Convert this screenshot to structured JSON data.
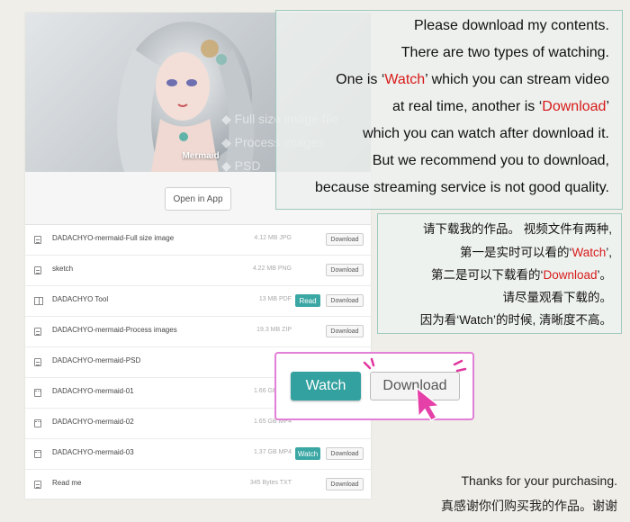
{
  "cover": {
    "title": "Mermaid",
    "features": [
      "Full size image file",
      "Process images",
      "PSD"
    ]
  },
  "open_button": "Open in App",
  "files": [
    {
      "icon": "document-icon",
      "name": "DADACHYO-mermaid-Full size image",
      "meta": "4.12 MB JPG",
      "read": "",
      "download": "Download"
    },
    {
      "icon": "document-icon",
      "name": "sketch",
      "meta": "4.22 MB PNG",
      "read": "",
      "download": "Download"
    },
    {
      "icon": "book-icon",
      "name": "DADACHYO Tool",
      "meta": "13 MB PDF",
      "read": "Read",
      "download": "Download"
    },
    {
      "icon": "document-icon",
      "name": "DADACHYO-mermaid-Process images",
      "meta": "19.3 MB ZIP",
      "read": "",
      "download": "Download"
    },
    {
      "icon": "document-icon",
      "name": "DADACHYO-mermaid-PSD",
      "meta": "",
      "read": "",
      "download": ""
    },
    {
      "icon": "video-icon",
      "name": "DADACHYO-mermaid-01",
      "meta": "1.66 GB MP4",
      "read": "",
      "download": ""
    },
    {
      "icon": "video-icon",
      "name": "DADACHYO-mermaid-02",
      "meta": "1.65 GB MP4",
      "read": "",
      "download": ""
    },
    {
      "icon": "video-icon",
      "name": "DADACHYO-mermaid-03",
      "meta": "1.37 GB MP4",
      "read": "Watch",
      "download": "Download"
    },
    {
      "icon": "document-icon",
      "name": "Read me",
      "meta": "345 Bytes TXT",
      "read": "",
      "download": "Download"
    }
  ],
  "note_en": {
    "l1": "Please download my contents.",
    "l2": "There are two types of watching.",
    "l3a": "One is ‘",
    "l3b": "Watch",
    "l3c": "’ which you can stream video",
    "l4a": "at real time, another is ‘",
    "l4b": "Download",
    "l4c": "’",
    "l5": "which you can watch after download it.",
    "l6": "But we recommend you to download,",
    "l7": "because streaming service is not good quality."
  },
  "note_cn": {
    "l1": "请下载我的作品。 视频文件有两种,",
    "l2a": "第一是实时可以看的‘",
    "l2b": "Watch",
    "l2c": "’,",
    "l3a": "第二是可以下载看的‘",
    "l3b": "Download",
    "l3c": "’。",
    "l4": "请尽量观看下载的。",
    "l5": "因为看‘Watch’的时候, 清晰度不高。"
  },
  "callout": {
    "watch": "Watch",
    "download": "Download"
  },
  "thanks": {
    "en": "Thanks for your purchasing.",
    "cn": "真感谢你们购买我的作品。谢谢"
  },
  "colors": {
    "accent_teal": "#33a19f",
    "highlight_red": "#d71a1a",
    "callout_pink": "#e27fd6",
    "note_border": "#9fc9bf"
  }
}
